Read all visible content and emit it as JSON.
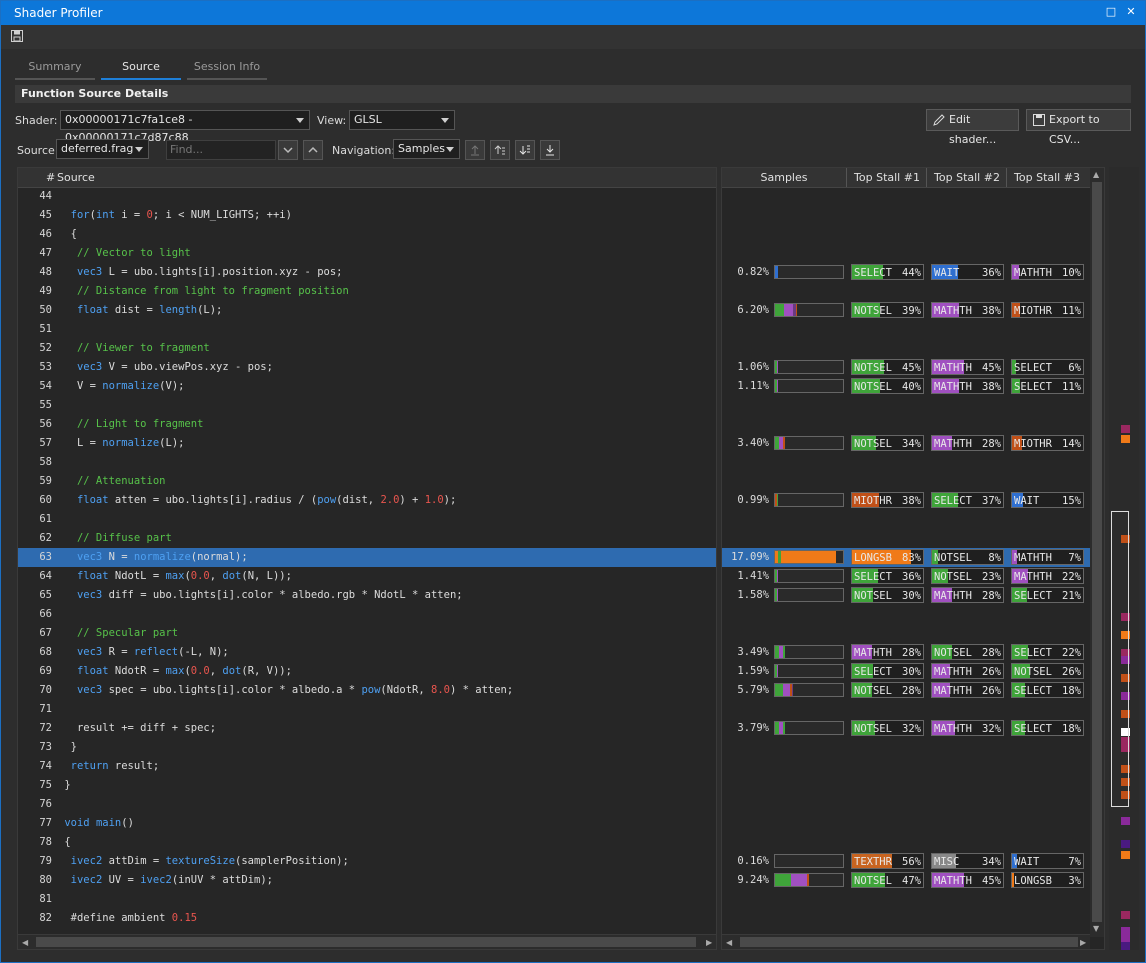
{
  "window": {
    "title": "Shader Profiler"
  },
  "tabs": [
    "Summary",
    "Source",
    "Session Info"
  ],
  "active_tab": "Source",
  "section_title": "Function Source Details",
  "controls": {
    "shader_label": "Shader:",
    "shader_value": "0x00000171c7fa1ce8 - 0x00000171c7d87c88",
    "view_label": "View:",
    "view_value": "GLSL",
    "edit_button": "Edit shader...",
    "export_button": "Export to CSV...",
    "source_label": "Source:",
    "source_value": "deferred.frag",
    "find_placeholder": "Find...",
    "navigation_label": "Navigation:",
    "navigation_value": "Samples"
  },
  "columns": {
    "source": [
      "#",
      "Source"
    ],
    "stats": [
      "Samples",
      "Top Stall #1",
      "Top Stall #2",
      "Top Stall #3"
    ]
  },
  "colors": {
    "SELECT": "#3fa43a",
    "WAIT": "#2f6fd0",
    "MATHTH": "#a050c0",
    "NOTSEL": "#3fa43a",
    "MIOTHR": "#c05018",
    "LONGSB": "#f07a18",
    "TEXTHR": "#c86420",
    "MISC": "#888888",
    "selection": "#2e6bb0",
    "accent": "#1e7fd8"
  },
  "lines": [
    {
      "n": "44",
      "code": ""
    },
    {
      "n": "45",
      "code": "  for(int i = 0; i < NUM_LIGHTS; ++i)"
    },
    {
      "n": "46",
      "code": "  {"
    },
    {
      "n": "47",
      "code": "   // Vector to light"
    },
    {
      "n": "48",
      "code": "   vec3 L = ubo.lights[i].position.xyz - pos;",
      "pct": "0.82%",
      "bar": [
        [
          "#2f6fd0",
          3
        ]
      ],
      "stalls": [
        [
          "SELECT",
          "44%"
        ],
        [
          "WAIT",
          "36%"
        ],
        [
          "MATHTH",
          "10%"
        ]
      ]
    },
    {
      "n": "49",
      "code": "   // Distance from light to fragment position"
    },
    {
      "n": "50",
      "code": "   float dist = length(L);",
      "pct": "6.20%",
      "bar": [
        [
          "#3fa43a",
          9
        ],
        [
          "#a050c0",
          9
        ],
        [
          "#6a3a80",
          3
        ],
        [
          "#c05018",
          1
        ]
      ],
      "stalls": [
        [
          "NOTSEL",
          "39%"
        ],
        [
          "MATHTH",
          "38%"
        ],
        [
          "MIOTHR",
          "11%"
        ]
      ]
    },
    {
      "n": "51",
      "code": ""
    },
    {
      "n": "52",
      "code": "   // Viewer to fragment"
    },
    {
      "n": "53",
      "code": "   vec3 V = ubo.viewPos.xyz - pos;",
      "pct": "1.06%",
      "bar": [
        [
          "#3fa43a",
          2
        ],
        [
          "#a050c0",
          1
        ]
      ],
      "stalls": [
        [
          "NOTSEL",
          "45%"
        ],
        [
          "MATHTH",
          "45%"
        ],
        [
          "SELECT",
          "6%"
        ]
      ]
    },
    {
      "n": "54",
      "code": "   V = normalize(V);",
      "pct": "1.11%",
      "bar": [
        [
          "#3fa43a",
          2
        ],
        [
          "#a050c0",
          1
        ]
      ],
      "stalls": [
        [
          "NOTSEL",
          "40%"
        ],
        [
          "MATHTH",
          "38%"
        ],
        [
          "SELECT",
          "11%"
        ]
      ]
    },
    {
      "n": "55",
      "code": ""
    },
    {
      "n": "56",
      "code": "   // Light to fragment"
    },
    {
      "n": "57",
      "code": "   L = normalize(L);",
      "pct": "3.40%",
      "bar": [
        [
          "#3fa43a",
          4
        ],
        [
          "#a050c0",
          4
        ],
        [
          "#c05018",
          2
        ]
      ],
      "stalls": [
        [
          "NOTSEL",
          "34%"
        ],
        [
          "MATHTH",
          "28%"
        ],
        [
          "MIOTHR",
          "14%"
        ]
      ]
    },
    {
      "n": "58",
      "code": ""
    },
    {
      "n": "59",
      "code": "   // Attenuation"
    },
    {
      "n": "60",
      "code": "   float atten = ubo.lights[i].radius / (pow(dist, 2.0) + 1.0);",
      "pct": "0.99%",
      "bar": [
        [
          "#c05018",
          2
        ],
        [
          "#3fa43a",
          1
        ]
      ],
      "stalls": [
        [
          "MIOTHR",
          "38%"
        ],
        [
          "SELECT",
          "37%"
        ],
        [
          "WAIT",
          "15%"
        ]
      ]
    },
    {
      "n": "61",
      "code": ""
    },
    {
      "n": "62",
      "code": "   // Diffuse part"
    },
    {
      "n": "63",
      "code": "   vec3 N = normalize(normal);",
      "sel": true,
      "pct": "17.09%",
      "bar": [
        [
          "#f07a18",
          3
        ],
        [
          "#3fa43a",
          3
        ],
        [
          "#f07a18",
          55
        ]
      ],
      "stalls": [
        [
          "LONGSB",
          "83%"
        ],
        [
          "NOTSEL",
          "8%"
        ],
        [
          "MATHTH",
          "7%"
        ]
      ]
    },
    {
      "n": "64",
      "code": "   float NdotL = max(0.0, dot(N, L));",
      "pct": "1.41%",
      "bar": [
        [
          "#3fa43a",
          2
        ],
        [
          "#a050c0",
          1
        ]
      ],
      "stalls": [
        [
          "SELECT",
          "36%"
        ],
        [
          "NOTSEL",
          "23%"
        ],
        [
          "MATHTH",
          "22%"
        ]
      ]
    },
    {
      "n": "65",
      "code": "   vec3 diff = ubo.lights[i].color * albedo.rgb * NdotL * atten;",
      "pct": "1.58%",
      "bar": [
        [
          "#3fa43a",
          2
        ],
        [
          "#a050c0",
          1
        ]
      ],
      "stalls": [
        [
          "NOTSEL",
          "30%"
        ],
        [
          "MATHTH",
          "28%"
        ],
        [
          "SELECT",
          "21%"
        ]
      ]
    },
    {
      "n": "66",
      "code": ""
    },
    {
      "n": "67",
      "code": "   // Specular part"
    },
    {
      "n": "68",
      "code": "   vec3 R = reflect(-L, N);",
      "pct": "3.49%",
      "bar": [
        [
          "#3fa43a",
          4
        ],
        [
          "#a050c0",
          4
        ],
        [
          "#3fa43a",
          2
        ]
      ],
      "stalls": [
        [
          "MATHTH",
          "28%"
        ],
        [
          "NOTSEL",
          "28%"
        ],
        [
          "SELECT",
          "22%"
        ]
      ]
    },
    {
      "n": "69",
      "code": "   float NdotR = max(0.0, dot(R, V));",
      "pct": "1.59%",
      "bar": [
        [
          "#3fa43a",
          2
        ],
        [
          "#a050c0",
          1
        ]
      ],
      "stalls": [
        [
          "SELECT",
          "30%"
        ],
        [
          "MATHTH",
          "26%"
        ],
        [
          "NOTSEL",
          "26%"
        ]
      ]
    },
    {
      "n": "70",
      "code": "   vec3 spec = ubo.lights[i].color * albedo.a * pow(NdotR, 8.0) * atten;",
      "pct": "5.79%",
      "bar": [
        [
          "#3fa43a",
          8
        ],
        [
          "#a050c0",
          7
        ],
        [
          "#c05018",
          2
        ],
        [
          "#6a3a80",
          1
        ]
      ],
      "stalls": [
        [
          "NOTSEL",
          "28%"
        ],
        [
          "MATHTH",
          "26%"
        ],
        [
          "SELECT",
          "18%"
        ]
      ]
    },
    {
      "n": "71",
      "code": ""
    },
    {
      "n": "72",
      "code": "   result += diff + spec;",
      "pct": "3.79%",
      "bar": [
        [
          "#3fa43a",
          4
        ],
        [
          "#a050c0",
          4
        ],
        [
          "#3fa43a",
          2
        ]
      ],
      "stalls": [
        [
          "NOTSEL",
          "32%"
        ],
        [
          "MATHTH",
          "32%"
        ],
        [
          "SELECT",
          "18%"
        ]
      ]
    },
    {
      "n": "73",
      "code": "  }"
    },
    {
      "n": "74",
      "code": "  return result;"
    },
    {
      "n": "75",
      "code": " }"
    },
    {
      "n": "76",
      "code": ""
    },
    {
      "n": "77",
      "code": " void main()"
    },
    {
      "n": "78",
      "code": " {"
    },
    {
      "n": "79",
      "code": "  ivec2 attDim = textureSize(samplerPosition);",
      "pct": "0.16%",
      "bar": [],
      "stalls": [
        [
          "TEXTHR",
          "56%"
        ],
        [
          "MISC",
          "34%"
        ],
        [
          "WAIT",
          "7%"
        ]
      ]
    },
    {
      "n": "80",
      "code": "  ivec2 UV = ivec2(inUV * attDim);",
      "pct": "9.24%",
      "bar": [
        [
          "#3fa43a",
          16
        ],
        [
          "#a050c0",
          16
        ],
        [
          "#c05018",
          2
        ]
      ],
      "stalls": [
        [
          "NOTSEL",
          "47%"
        ],
        [
          "MATHTH",
          "45%"
        ],
        [
          "LONGSB",
          "3%"
        ]
      ]
    },
    {
      "n": "81",
      "code": ""
    },
    {
      "n": "82",
      "code": "  #define ambient 0.15"
    }
  ],
  "minimap": [
    {
      "y": 0.33,
      "c": "#9a2860"
    },
    {
      "y": 0.342,
      "c": "#f07a18"
    },
    {
      "y": 0.47,
      "c": "#c05018"
    },
    {
      "y": 0.57,
      "c": "#9a2860"
    },
    {
      "y": 0.592,
      "c": "#f07a18"
    },
    {
      "y": 0.615,
      "c": "#9a2860"
    },
    {
      "y": 0.625,
      "c": "#8a2a9a"
    },
    {
      "y": 0.647,
      "c": "#c05018"
    },
    {
      "y": 0.67,
      "c": "#8a2a9a"
    },
    {
      "y": 0.693,
      "c": "#c05018"
    },
    {
      "y": 0.716,
      "c": "#ffffff"
    },
    {
      "y": 0.728,
      "c": "#9a2860"
    },
    {
      "y": 0.737,
      "c": "#9a2860"
    },
    {
      "y": 0.764,
      "c": "#c05018"
    },
    {
      "y": 0.78,
      "c": "#c05018"
    },
    {
      "y": 0.797,
      "c": "#c05018"
    },
    {
      "y": 0.83,
      "c": "#8a2a9a"
    },
    {
      "y": 0.86,
      "c": "#4a1a80"
    },
    {
      "y": 0.874,
      "c": "#f07a18"
    },
    {
      "y": 0.95,
      "c": "#9a2860"
    },
    {
      "y": 0.97,
      "c": "#8a2a9a"
    },
    {
      "y": 0.98,
      "c": "#8a2a9a"
    },
    {
      "y": 0.99,
      "c": "#4a1a80"
    }
  ]
}
